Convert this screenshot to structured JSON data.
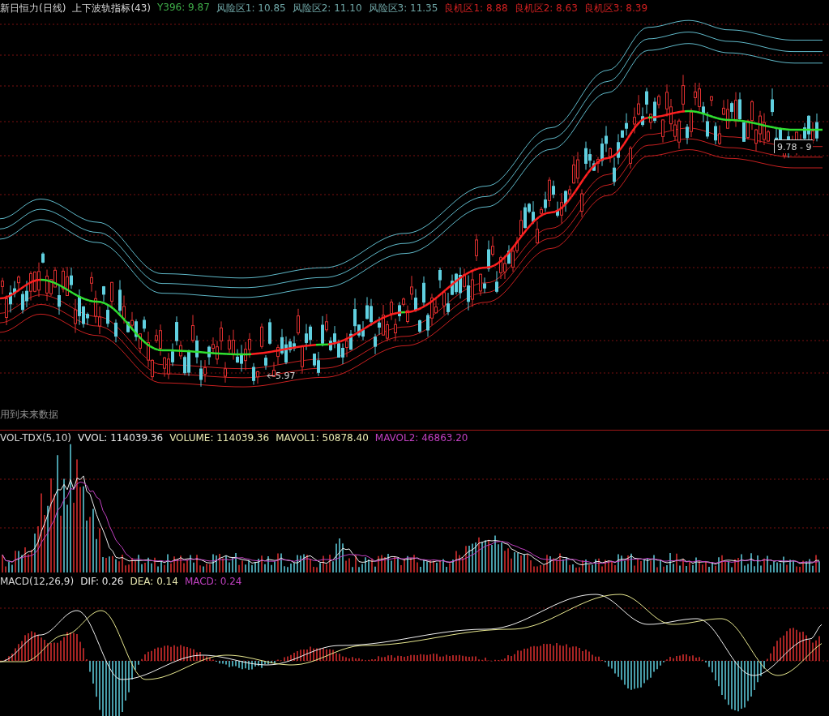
{
  "main_panel": {
    "title": "新日恒力(日线)",
    "indicator": "上下波轨指标(43)",
    "readings": [
      {
        "text": "Y396: 9.87",
        "color": "#3fae49"
      },
      {
        "text": "风险区1: 10.85",
        "color": "#6fa6a6"
      },
      {
        "text": "风险区2: 11.10",
        "color": "#6fa6a6"
      },
      {
        "text": "风险区3: 11.35",
        "color": "#6fa6a6"
      },
      {
        "text": "良机区1: 8.88",
        "color": "#d02020"
      },
      {
        "text": "良机区2: 8.63",
        "color": "#d02020"
      },
      {
        "text": "良机区3: 8.39",
        "color": "#d02020"
      }
    ],
    "price_label": "9.78 - 9",
    "low_label": "5.97",
    "note": "用到未来数据"
  },
  "volume_panel": {
    "title": "VOL-TDX(5,10)",
    "readings": [
      {
        "text": "VVOL: 114039.36",
        "color": "#e8e8e8"
      },
      {
        "text": "VOLUME: 114039.36",
        "color": "#e8e8b0"
      },
      {
        "text": "MAVOL1: 50878.40",
        "color": "#e8e8b0"
      },
      {
        "text": "MAVOL2: 46863.20",
        "color": "#c040c0"
      }
    ]
  },
  "macd_panel": {
    "title": "MACD(12,26,9)",
    "readings": [
      {
        "text": "DIF: 0.26",
        "color": "#e8e8e8"
      },
      {
        "text": "DEA: 0.14",
        "color": "#e8e8b0"
      },
      {
        "text": "MACD: 0.24",
        "color": "#c040c0"
      }
    ]
  }
}
